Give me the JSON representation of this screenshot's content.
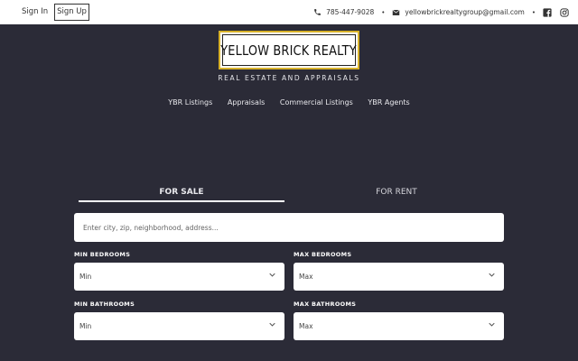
{
  "topbar": {
    "sign_in": "Sign In",
    "sign_up": "Sign Up",
    "phone": "785-447-9028",
    "email": "yellowbrickrealtygroup@gmail.com",
    "separator": "•"
  },
  "brand": {
    "logo_text": "YELLOW BRICK REALTY",
    "tagline": "REAL ESTATE AND APPRAISALS",
    "accent_color": "#d8b22a",
    "background_color": "#2b2b37"
  },
  "nav": {
    "items": [
      "YBR Listings",
      "Appraisals",
      "Commercial Listings",
      "YBR Agents"
    ]
  },
  "search": {
    "tabs": [
      "FOR SALE",
      "FOR RENT"
    ],
    "active_tab": "FOR SALE",
    "placeholder": "Enter city, zip, neighborhood, address..."
  },
  "filters": {
    "min_bedrooms": {
      "label": "MIN BEDROOMS",
      "value": "Min"
    },
    "max_bedrooms": {
      "label": "MAX BEDROOMS",
      "value": "Max"
    },
    "min_bathrooms": {
      "label": "MIN BATHROOMS",
      "value": "Min"
    },
    "max_bathrooms": {
      "label": "MAX BATHROOMS",
      "value": "Max"
    }
  },
  "icons": [
    "phone-icon",
    "envelope-icon",
    "facebook-icon",
    "instagram-icon",
    "chevron-down-icon"
  ]
}
